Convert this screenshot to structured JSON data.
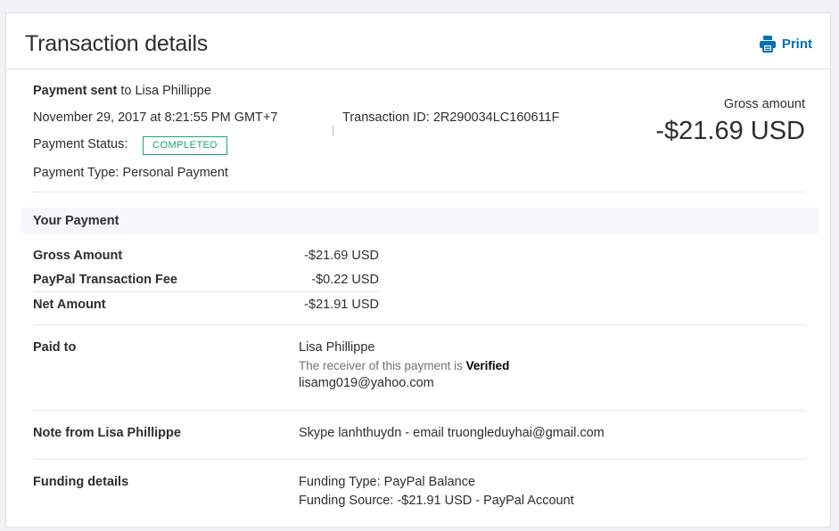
{
  "header": {
    "title": "Transaction details",
    "print_label": "Print"
  },
  "summary": {
    "payment_sent_label": "Payment sent",
    "recipient_text": " to Lisa Phillippe",
    "datetime": "November 29, 2017 at 8:21:55 PM GMT+7",
    "transaction_id_label": "Transaction ID:",
    "transaction_id": "2R290034LC160611F",
    "status_label": "Payment Status:",
    "status_value": "COMPLETED",
    "type_label": "Payment Type:",
    "type_value": "Personal Payment",
    "gross_label": "Gross amount",
    "gross_value": "-$21.69 USD"
  },
  "your_payment": {
    "title": "Your Payment",
    "rows": [
      {
        "label": "Gross Amount",
        "value": "-$21.69 USD"
      },
      {
        "label": "PayPal Transaction Fee",
        "value": "-$0.22 USD"
      },
      {
        "label": "Net Amount",
        "value": "-$21.91 USD"
      }
    ]
  },
  "paid_to": {
    "label": "Paid to",
    "name": "Lisa Phillippe",
    "verified_prefix": "The receiver of this payment is",
    "verified_word": "Verified",
    "email": "lisamg019@yahoo.com"
  },
  "note": {
    "label": "Note from Lisa Phillippe",
    "text": "Skype lanhthuydn - email truongleduyhai@gmail.com"
  },
  "funding": {
    "label": "Funding details",
    "type_line": "Funding Type: PayPal Balance",
    "source_line": "Funding Source: -$21.91 USD - PayPal Account"
  },
  "colors": {
    "accent": "#0070ba",
    "status_green": "#1aa66b",
    "text": "#2c2e2f",
    "muted": "#6c7378"
  },
  "icons": {
    "print": "printer-icon"
  }
}
